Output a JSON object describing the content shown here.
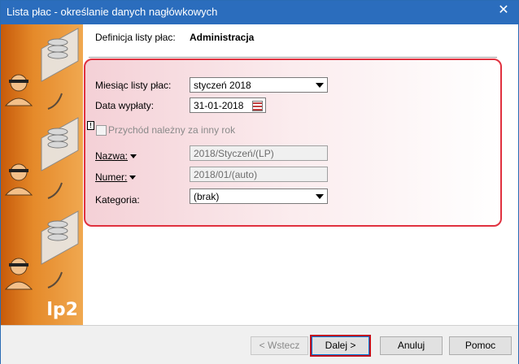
{
  "window": {
    "title": "Lista płac - określanie danych nagłówkowych",
    "close_glyph": "✕"
  },
  "sidebar": {
    "logo_text": "lp2"
  },
  "header": {
    "definition_label": "Definicja listy płac:",
    "definition_value": "Administracja"
  },
  "form": {
    "month_label": "Miesiąc listy płac:",
    "month_value": "styczeń 2018",
    "pay_date_label": "Data wypłaty:",
    "pay_date_value": "31-01-2018",
    "income_other_year_label": "Przychód należny za inny rok",
    "warning_glyph": "!",
    "name_label": "Nazwa:",
    "name_value": "2018/Styczeń/(LP)",
    "number_label": "Numer:",
    "number_value": "2018/01/(auto)",
    "category_label": "Kategoria:",
    "category_value": "(brak)"
  },
  "buttons": {
    "back": "< Wstecz",
    "next": "Dalej >",
    "cancel": "Anuluj",
    "help": "Pomoc"
  },
  "colors": {
    "titlebar": "#2b6dbd",
    "highlight": "#e0313f",
    "sidebar": "#e58a2a"
  }
}
